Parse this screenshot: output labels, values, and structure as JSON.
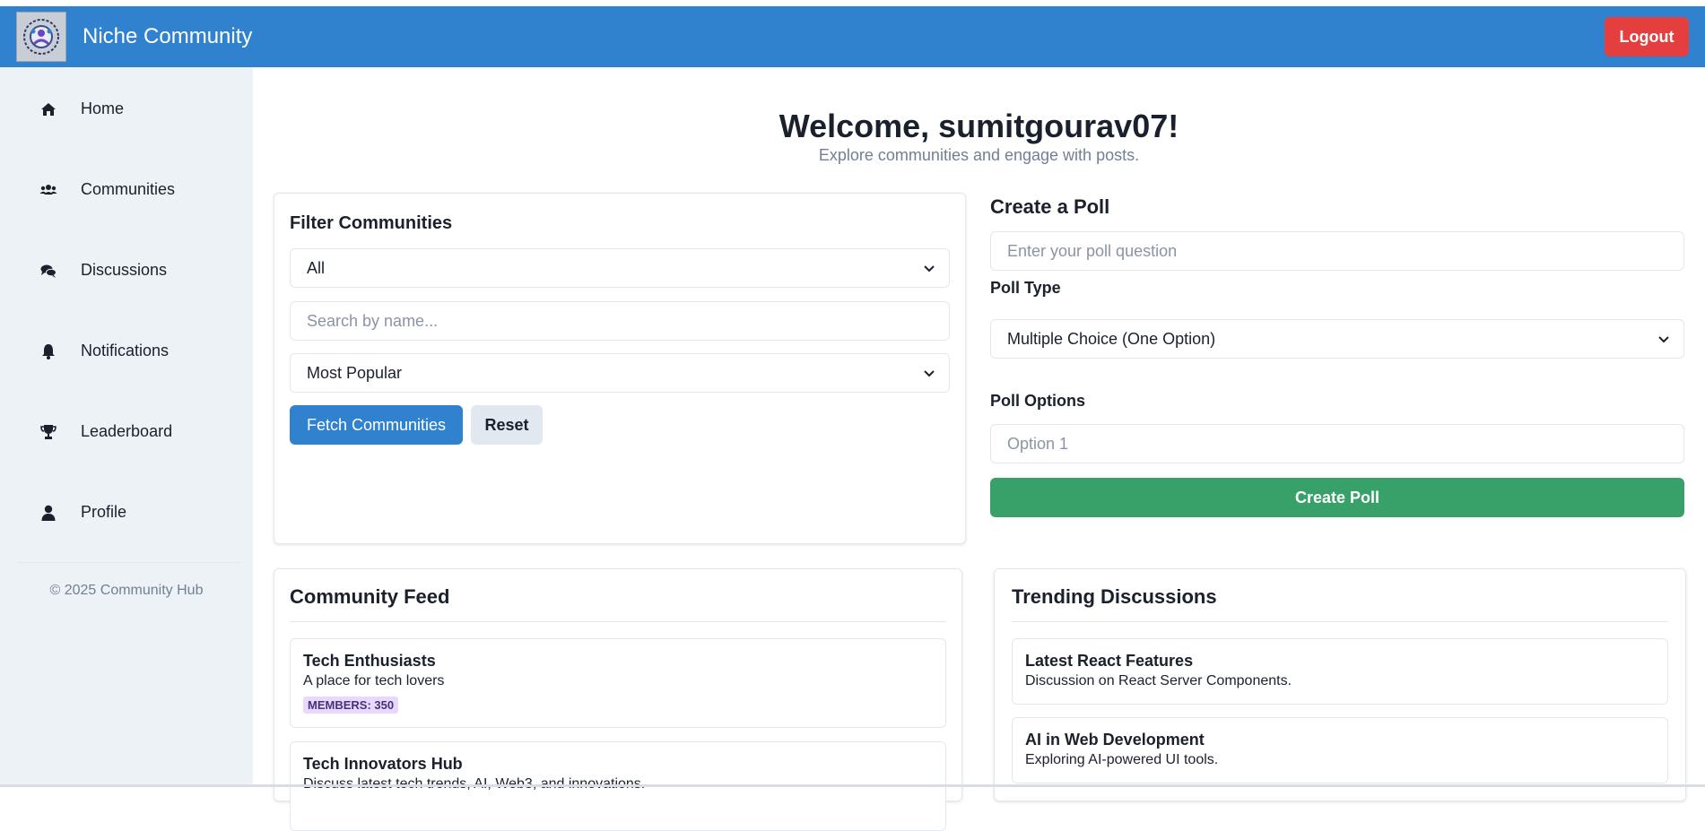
{
  "header": {
    "brand": "Niche Community",
    "logout_label": "Logout"
  },
  "sidebar": {
    "items": [
      {
        "label": "Home",
        "icon": "home-icon"
      },
      {
        "label": "Communities",
        "icon": "users-icon"
      },
      {
        "label": "Discussions",
        "icon": "comments-icon"
      },
      {
        "label": "Notifications",
        "icon": "bell-icon"
      },
      {
        "label": "Leaderboard",
        "icon": "trophy-icon"
      },
      {
        "label": "Profile",
        "icon": "user-icon"
      }
    ],
    "copyright": "© 2025 Community Hub"
  },
  "main": {
    "welcome": "Welcome, sumitgourav07!",
    "subtitle": "Explore communities and engage with posts."
  },
  "filter": {
    "title": "Filter Communities",
    "category_value": "All",
    "search_placeholder": "Search by name...",
    "sort_value": "Most Popular",
    "fetch_label": "Fetch Communities",
    "reset_label": "Reset"
  },
  "poll": {
    "title": "Create a Poll",
    "question_placeholder": "Enter your poll question",
    "type_label": "Poll Type",
    "type_value": "Multiple Choice (One Option)",
    "options_label": "Poll Options",
    "option1_placeholder": "Option 1",
    "create_label": "Create Poll"
  },
  "feed": {
    "title": "Community Feed",
    "items": [
      {
        "name": "Tech Enthusiasts",
        "desc": "A place for tech lovers",
        "badge": "MEMBERS: 350"
      },
      {
        "name": "Tech Innovators Hub",
        "desc": "Discuss latest tech trends, AI, Web3, and innovations."
      }
    ]
  },
  "trending": {
    "title": "Trending Discussions",
    "items": [
      {
        "name": "Latest React Features",
        "desc": "Discussion on React Server Components."
      },
      {
        "name": "AI in Web Development",
        "desc": "Exploring AI-powered UI tools."
      }
    ]
  },
  "colors": {
    "header": "#3182ce",
    "logout": "#e53e3e",
    "sidebar": "#edf2f7",
    "primary": "#3182ce",
    "create_poll": "#38a169",
    "badge_bg": "#e9d8fd"
  }
}
